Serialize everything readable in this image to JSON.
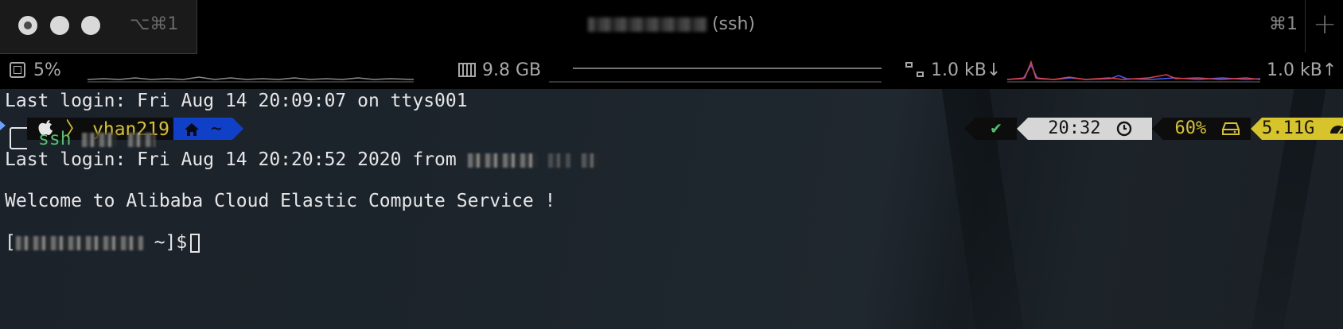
{
  "window": {
    "tab_shortcut": "⌥⌘1",
    "title_suffix": "(ssh)",
    "cmd_shortcut": "⌘1",
    "new_tab_label": "+"
  },
  "status_bar": {
    "cpu": "5%",
    "memory": "9.8 GB",
    "net_down": "1.0 kB↓",
    "net_up": "1.0 kB↑"
  },
  "terminal": {
    "last_login_local": "Last login: Fri Aug 14 20:09:07 on ttys001",
    "prompt": {
      "os_icon": "apple-icon",
      "user": "yhan219",
      "dir": "~",
      "status_icon": "check-icon",
      "time": "20:32",
      "battery": "60%",
      "memory": "5.11G"
    },
    "command": "ssh",
    "last_login_remote": "Last login: Fri Aug 14 20:20:52 2020 from",
    "welcome": "Welcome to Alibaba Cloud Elastic Compute Service !",
    "remote_prompt_open": "[",
    "remote_prompt_close": " ~]$"
  },
  "colors": {
    "prompt_yellow": "#d7c32a",
    "dir_blue": "#1040c8",
    "status_green": "#4cc26a",
    "net_red": "#e04040",
    "net_blue": "#4a5cff"
  }
}
